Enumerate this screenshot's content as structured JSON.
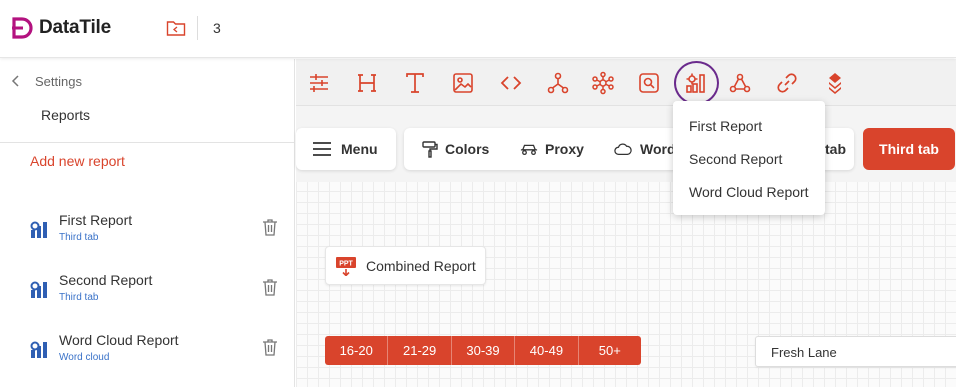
{
  "header": {
    "logo_text": "DataTile",
    "count": "3"
  },
  "sidebar": {
    "breadcrumb": "Settings",
    "title": "Reports",
    "add_label": "Add new report",
    "reports": [
      {
        "title": "First Report",
        "subtitle": "Third tab"
      },
      {
        "title": "Second Report",
        "subtitle": "Third tab"
      },
      {
        "title": "Word Cloud Report",
        "subtitle": "Word cloud"
      }
    ]
  },
  "toolbar": {
    "icons": [
      "filter-sliders-icon",
      "heading-icon",
      "text-icon",
      "image-icon",
      "code-icon",
      "network-icon",
      "cluster-icon",
      "search-box-icon",
      "report-settings-icon",
      "webhook-icon",
      "link-icon",
      "layers-icon"
    ],
    "highlighted_icon": "report-settings-icon"
  },
  "tabs": {
    "menu_label": "Menu",
    "items": [
      {
        "label": "Colors",
        "icon": "paint-roller-icon"
      },
      {
        "label": "Proxy",
        "icon": "car-icon"
      },
      {
        "label": "Word",
        "icon": "cloud-icon"
      },
      {
        "label": "tab",
        "icon": ""
      }
    ],
    "active_label": "Third tab"
  },
  "dropdown": {
    "items": [
      "First Report",
      "Second Report",
      "Word Cloud Report"
    ]
  },
  "canvas": {
    "combined_label": "Combined Report",
    "ppt_badge": "PPT",
    "age_groups": [
      "16-20",
      "21-29",
      "30-39",
      "40-49",
      "50+"
    ],
    "fresh_lane": "Fresh Lane"
  },
  "colors": {
    "accent": "#d9442c",
    "logo": "#b3127f",
    "highlight_ring": "#6a2a8c",
    "report_icon": "#2f5fb3"
  }
}
